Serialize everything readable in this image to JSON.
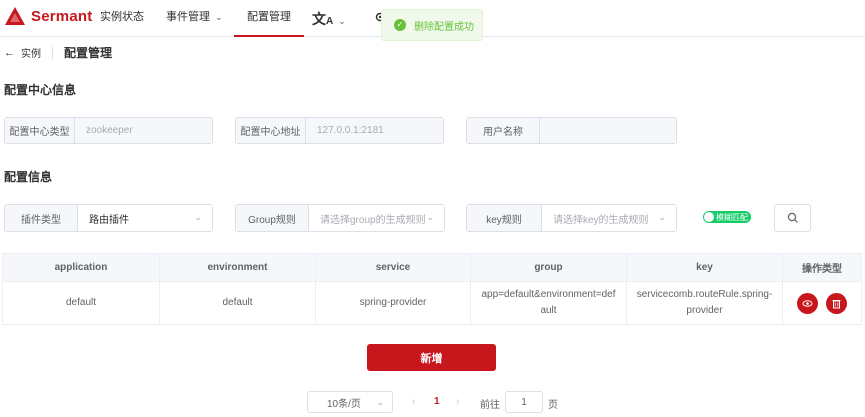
{
  "brand": {
    "name": "Sermant",
    "color": "#c8161d"
  },
  "nav": {
    "items": [
      {
        "label": "实例状态"
      },
      {
        "label": "事件管理"
      },
      {
        "label": "配置管理",
        "active": true
      }
    ],
    "lang_icon": "translate-icon",
    "settings_icon": "gear-icon"
  },
  "toast": {
    "message": "删除配置成功",
    "icon": "check-circle-icon",
    "color": "#67c23a"
  },
  "breadcrumb": {
    "back": "实例",
    "title": "配置管理"
  },
  "center_section": {
    "title": "配置中心信息",
    "fields": [
      {
        "label": "配置中心类型",
        "value": "zookeeper"
      },
      {
        "label": "配置中心地址",
        "value": "127.0.0.1:2181"
      },
      {
        "label": "用户名称",
        "value": ""
      }
    ]
  },
  "config_section": {
    "title": "配置信息",
    "plugin_type": {
      "label": "插件类型",
      "value": "路由插件"
    },
    "group_rule": {
      "label": "Group规则",
      "placeholder": "请选择group的生成规则"
    },
    "key_rule": {
      "label": "key规则",
      "placeholder": "请选择key的生成规则"
    },
    "fuzzy_switch": {
      "label": "模糊匹配",
      "on": true,
      "color": "#13ce66"
    },
    "search_icon": "search-icon"
  },
  "table": {
    "headers": [
      "application",
      "environment",
      "service",
      "group",
      "key",
      "操作类型"
    ],
    "rows": [
      {
        "application": "default",
        "environment": "default",
        "service": "spring-provider",
        "group": "app=default&environment=default",
        "key": "servicecomb.routeRule.spring-provider",
        "actions": [
          "eye-icon",
          "trash-icon"
        ]
      }
    ]
  },
  "add_button": {
    "label": "新增"
  },
  "pagination": {
    "page_size": "10条/页",
    "current_page": "1",
    "goto_label": "前往",
    "goto_value": "1",
    "page_suffix": "页"
  }
}
